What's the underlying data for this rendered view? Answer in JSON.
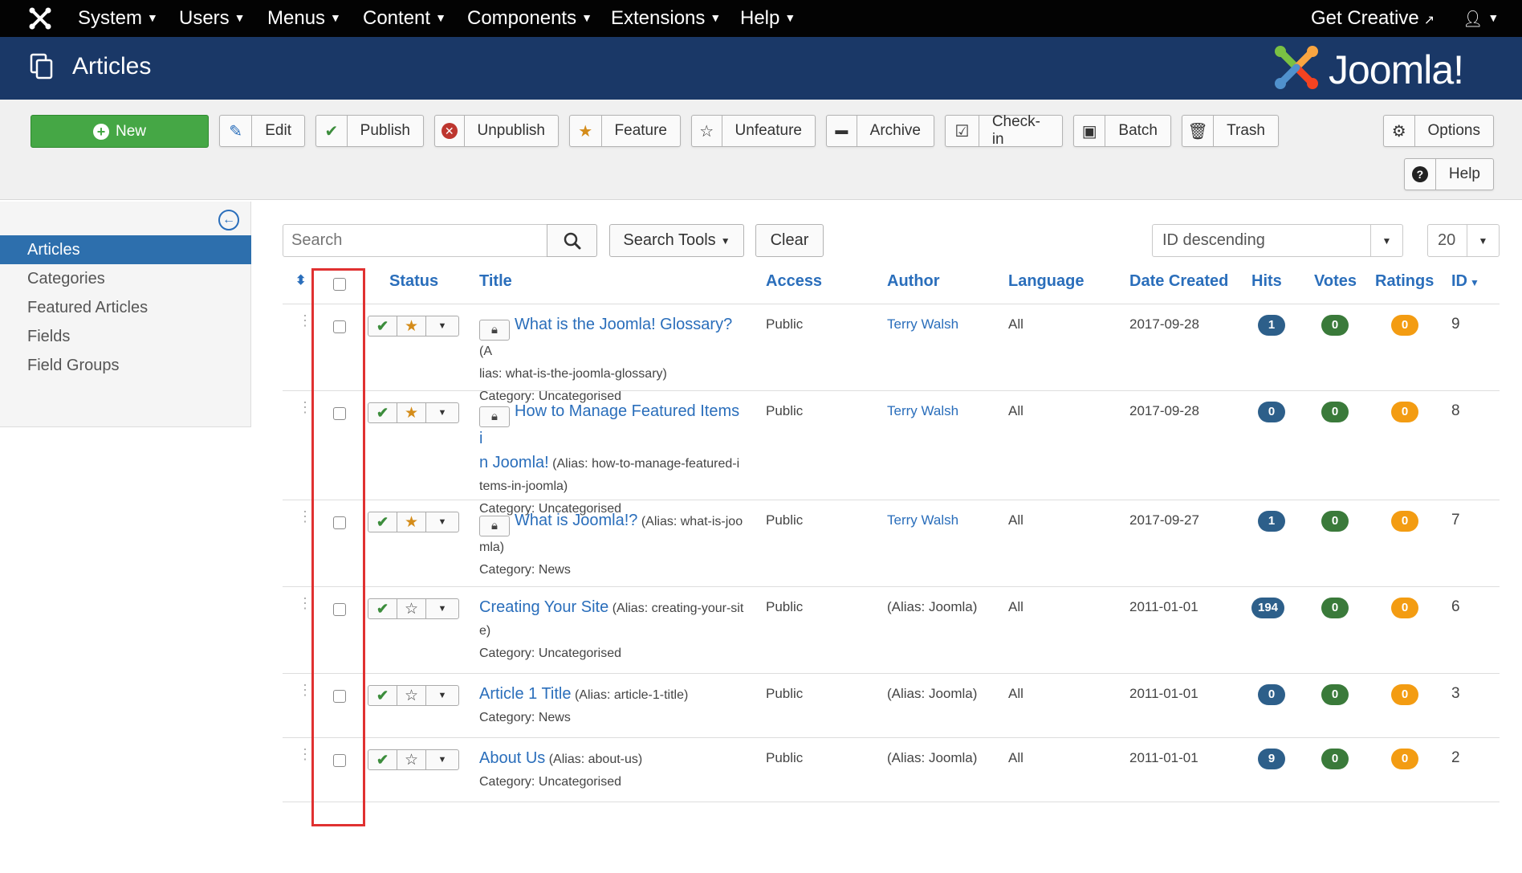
{
  "topnav": {
    "menus": [
      {
        "label": "System"
      },
      {
        "label": "Users"
      },
      {
        "label": "Menus"
      },
      {
        "label": "Content"
      },
      {
        "label": "Components"
      },
      {
        "label": "Extensions"
      },
      {
        "label": "Help"
      }
    ],
    "get_creative": "Get Creative",
    "user_icon": "user-icon"
  },
  "header": {
    "title": "Articles",
    "brand": "Joomla!"
  },
  "toolbar": {
    "new": "New",
    "edit": "Edit",
    "publish": "Publish",
    "unpublish": "Unpublish",
    "feature": "Feature",
    "unfeature": "Unfeature",
    "archive": "Archive",
    "checkin": "Check-in",
    "batch": "Batch",
    "trash": "Trash",
    "options": "Options",
    "help": "Help"
  },
  "sidebar": {
    "items": [
      {
        "label": "Articles"
      },
      {
        "label": "Categories"
      },
      {
        "label": "Featured Articles"
      },
      {
        "label": "Fields"
      },
      {
        "label": "Field Groups"
      }
    ]
  },
  "filters": {
    "search_placeholder": "Search",
    "search_tools": "Search Tools",
    "clear": "Clear",
    "ordering": "ID descending",
    "limit": "20"
  },
  "table": {
    "headers": {
      "status": "Status",
      "title": "Title",
      "access": "Access",
      "author": "Author",
      "language": "Language",
      "date": "Date Created",
      "hits": "Hits",
      "votes": "Votes",
      "ratings": "Ratings",
      "id": "ID"
    },
    "rows": [
      {
        "title": "What is the Joomla! Glossary?",
        "alias_lines": [
          "(A",
          "lias: what-is-the-joomla-glossary)"
        ],
        "locked": true,
        "featured": true,
        "category": "Category: Uncategorised",
        "access": "Public",
        "author": "Terry Walsh",
        "language": "All",
        "date": "2017-09-28",
        "hits": "1",
        "votes": "0",
        "ratings": "0",
        "id": "9"
      },
      {
        "title_lines": [
          "How to Manage Featured Items i",
          "n Joomla!"
        ],
        "alias_lines": [
          "(Alias: how-to-manage-featured-i",
          "tems-in-joomla)"
        ],
        "locked": true,
        "featured": true,
        "category": "Category: Uncategorised",
        "access": "Public",
        "author": "Terry Walsh",
        "language": "All",
        "date": "2017-09-28",
        "hits": "0",
        "votes": "0",
        "ratings": "0",
        "id": "8"
      },
      {
        "title": "What is Joomla!?",
        "alias_lines": [
          "(Alias: what-is-joo",
          "mla)"
        ],
        "locked": true,
        "featured": true,
        "category": "Category: News",
        "access": "Public",
        "author": "Terry Walsh",
        "language": "All",
        "date": "2017-09-27",
        "hits": "1",
        "votes": "0",
        "ratings": "0",
        "id": "7"
      },
      {
        "title": "Creating Your Site",
        "alias_lines": [
          "(Alias: creating-your-sit",
          "e)"
        ],
        "locked": false,
        "featured": false,
        "category": "Category: Uncategorised",
        "access": "Public",
        "author": "(Alias: Joomla)",
        "language": "All",
        "date": "2011-01-01",
        "hits": "194",
        "votes": "0",
        "ratings": "0",
        "id": "6"
      },
      {
        "title": "Article 1 Title",
        "alias_lines": [
          "(Alias: article-1-title)"
        ],
        "locked": false,
        "featured": false,
        "category": "Category: News",
        "access": "Public",
        "author": "(Alias: Joomla)",
        "language": "All",
        "date": "2011-01-01",
        "hits": "0",
        "votes": "0",
        "ratings": "0",
        "id": "3"
      },
      {
        "title": "About Us",
        "alias_lines": [
          "(Alias: about-us)"
        ],
        "locked": false,
        "featured": false,
        "category": "Category: Uncategorised",
        "access": "Public",
        "author": "(Alias: Joomla)",
        "language": "All",
        "date": "2011-01-01",
        "hits": "9",
        "votes": "0",
        "ratings": "0",
        "id": "2"
      }
    ]
  },
  "colors": {
    "topnav": "#030303",
    "header": "#1a3867",
    "accent": "#2a6ebb",
    "new_button": "#45a745",
    "highlight": "#e03131"
  }
}
